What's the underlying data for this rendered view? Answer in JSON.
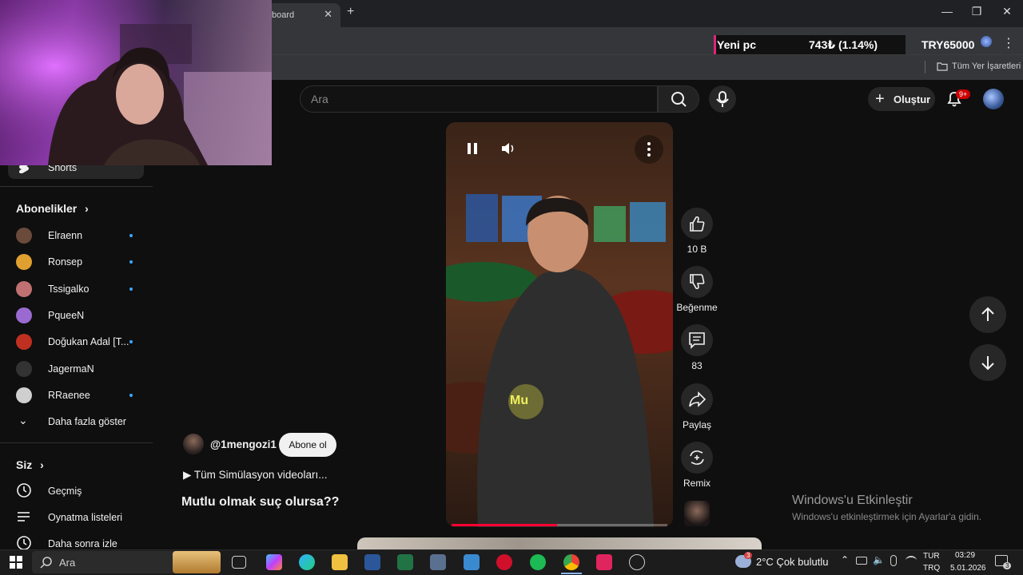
{
  "browser": {
    "tab_title": "board",
    "tab_close": "✕",
    "new_tab": "+",
    "min": "—",
    "max": "❐",
    "close": "✕",
    "bookmarks_label": "Tüm Yer İşaretleri"
  },
  "ticker": {
    "label": "Yeni pc",
    "change": "743₺ (1.14%)",
    "target": "TRY65000"
  },
  "header": {
    "search_placeholder": "Ara",
    "create_label": "Oluştur",
    "notif_count": "9+"
  },
  "sidebar": {
    "shorts_label": "Shorts",
    "subs_title": "Abonelikler",
    "subs": [
      {
        "name": "Elraenn",
        "new": true,
        "color": "#6a4a3a"
      },
      {
        "name": "Ronsep",
        "new": true,
        "color": "#e0a030"
      },
      {
        "name": "Tssigalko",
        "new": true,
        "color": "#c07070"
      },
      {
        "name": "PqueeN",
        "new": false,
        "color": "#9a6ad0"
      },
      {
        "name": "Doğukan Adal [T...",
        "new": true,
        "color": "#c03020"
      },
      {
        "name": "JagermaN",
        "new": false,
        "color": "#333333"
      },
      {
        "name": "RRaenee",
        "new": true,
        "color": "#cfcfcf"
      }
    ],
    "show_more": "Daha fazla göster",
    "you_title": "Siz",
    "history": "Geçmiş",
    "playlists": "Oynatma listeleri",
    "watch_later": "Daha sonra izle"
  },
  "short": {
    "caption": "Mu",
    "likes": "10 B",
    "dislike_label": "Beğenme",
    "comments": "83",
    "share_label": "Paylaş",
    "remix_label": "Remix",
    "channel": "@1mengozi1",
    "subscribe": "Abone ol",
    "playlist": "▶ Tüm Simülasyon videoları...",
    "title": "Mutlu olmak suç olursa??",
    "progress": 0.49
  },
  "watermark": {
    "line1": "Windows'u Etkinleştir",
    "line2": "Windows'u etkinleştirmek için Ayarlar'a gidin."
  },
  "taskbar": {
    "search": "Ara",
    "weather": "2°C  Çok bulutlu",
    "weather_badge": "3",
    "lang1": "TUR",
    "lang2": "TRQ",
    "time": "03:29",
    "date": "5.01.2026",
    "notif_count": "3"
  }
}
